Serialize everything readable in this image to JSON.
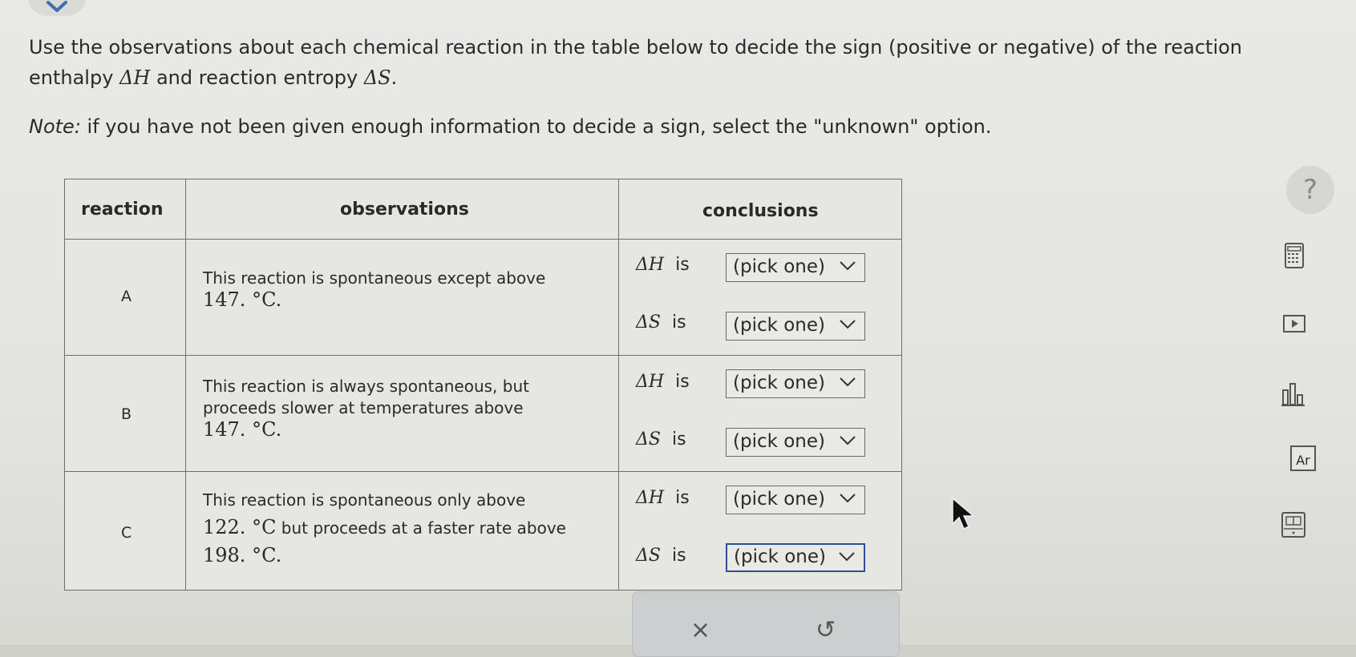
{
  "prompt": {
    "line1_a": "Use the observations about each chemical reaction in the table below to decide the sign (positive or negative) of the reaction",
    "line2_a": "enthalpy ",
    "delta_h": "ΔH",
    "line2_b": " and reaction entropy ",
    "delta_s": "ΔS",
    "line2_c": ".",
    "note_label": "Note:",
    "note_text": " if you have not been given enough information to decide a sign, select the \"unknown\" option."
  },
  "table": {
    "headers": {
      "reaction": "reaction",
      "observations": "observations",
      "conclusions": "conclusions"
    },
    "rows": [
      {
        "letter": "A",
        "obs_lines": [
          "This reaction is spontaneous except above"
        ],
        "obs_num": "147. °C."
      },
      {
        "letter": "B",
        "obs_lines": [
          "This reaction is always spontaneous, but",
          "proceeds slower at temperatures above"
        ],
        "obs_num": "147. °C."
      },
      {
        "letter": "C",
        "obs_l1": "This reaction is spontaneous only above",
        "obs_num_mid": "122. °C",
        "obs_l2": " but proceeds at a faster rate above",
        "obs_num": "198. °C."
      }
    ],
    "dh_label": "ΔH",
    "ds_label": "ΔS",
    "is_word": "is",
    "select_value": "(pick one)"
  },
  "actions": {
    "clear": "×",
    "undo": "↺"
  },
  "sidebar": {
    "help": "?",
    "ar_label": "Ar"
  },
  "icons": [
    "chevron-down-icon",
    "calculator-icon",
    "video-play-icon",
    "chart-icon",
    "periodic-table-icon",
    "reference-icon",
    "cursor-icon"
  ]
}
